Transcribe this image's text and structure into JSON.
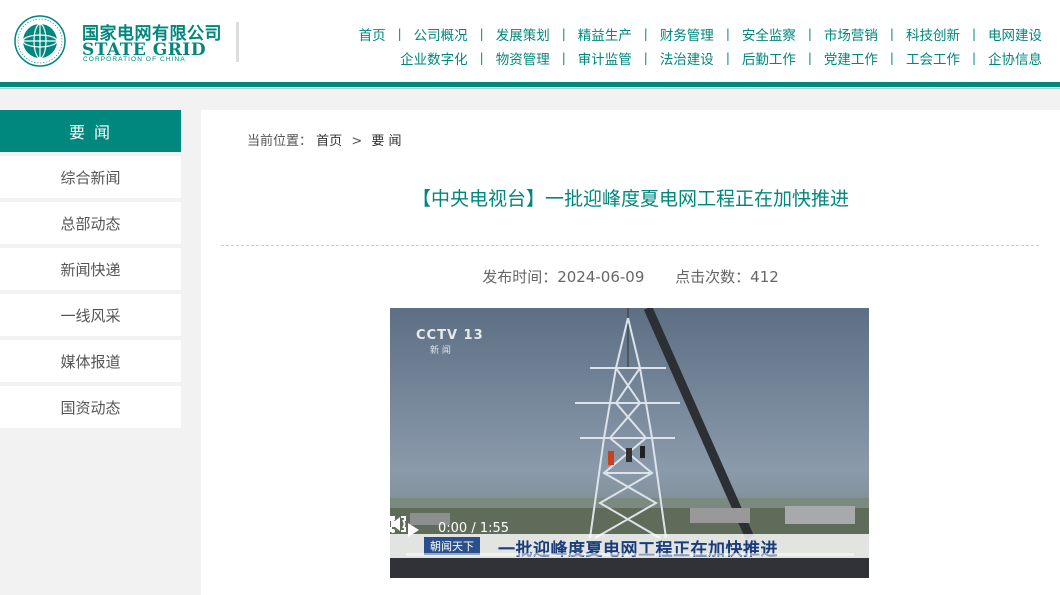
{
  "logo": {
    "cn": "国家电网有限公司",
    "en": "STATE GRID",
    "sub": "CORPORATION OF CHINA"
  },
  "nav": {
    "row1": [
      "首页",
      "公司概况",
      "发展策划",
      "精益生产",
      "财务管理",
      "安全监察",
      "市场营销",
      "科技创新",
      "电网建设"
    ],
    "row2": [
      "企业数字化",
      "物资管理",
      "审计监管",
      "法治建设",
      "后勤工作",
      "党建工作",
      "工会工作",
      "企协信息"
    ]
  },
  "sidebar": {
    "title": "要 闻",
    "items": [
      "综合新闻",
      "总部动态",
      "新闻快递",
      "一线风采",
      "媒体报道",
      "国资动态"
    ]
  },
  "breadcrumb": {
    "prefix": "当前位置：",
    "home": "首页",
    "sep": ">",
    "current": "要 闻"
  },
  "article": {
    "title": "【中央电视台】一批迎峰度夏电网工程正在加快推进",
    "publish": "发布时间：2024-06-09",
    "clicks": "点击次数：412"
  },
  "video": {
    "channel": "CCTV 13",
    "channel_sub": "新 闻",
    "tag": "朝闻天下",
    "caption": "一批迎峰度夏电网工程正在加快推进",
    "time": "0:00 / 1:55",
    "progress": 0
  },
  "colors": {
    "brand": "#00877e"
  }
}
